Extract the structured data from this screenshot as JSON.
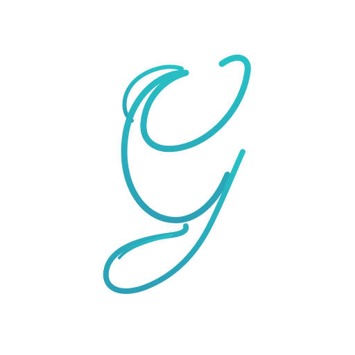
{
  "logo": {
    "name": "script-g-monogram-icon",
    "letter": "G",
    "colors": {
      "top": "#27c1c5",
      "bottom": "#2c9fb6"
    },
    "background": "#ffffff"
  }
}
